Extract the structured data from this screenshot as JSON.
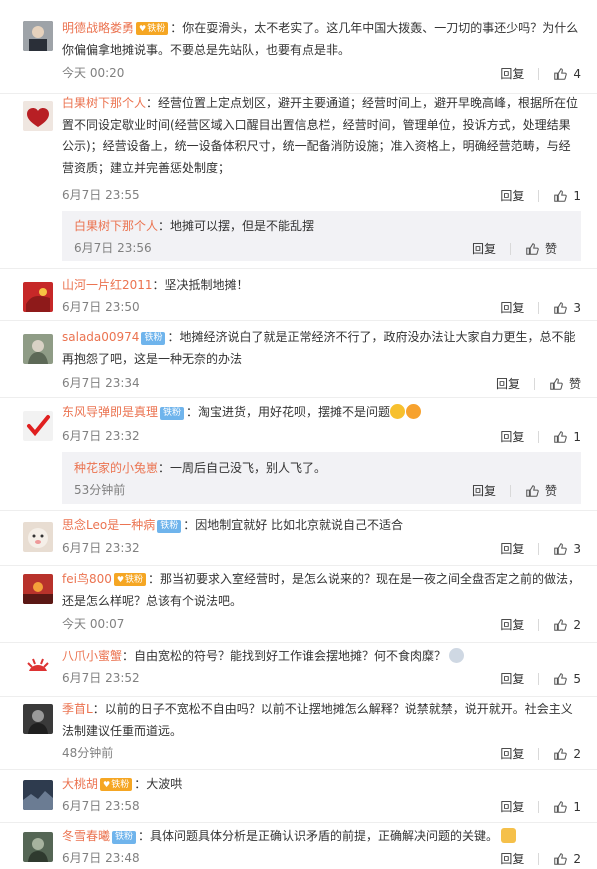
{
  "labels": {
    "reply": "回复",
    "like": "赞"
  },
  "comments": [
    {
      "user": "明德战略娄勇",
      "badge": "铁粉",
      "badge_vip": true,
      "text": "：你在耍滑头，太不老实了。这几年中国大拨轰、一刀切的事还少吗？为什么你偏偏拿地摊说事。不要总是先站队，也要有点是非。",
      "time": "今天 00:20",
      "likes": "4",
      "avatar_color": "#6c6f74"
    },
    {
      "user": "白果树下那个人",
      "badge": "",
      "text": "：经营位置上定点划区，避开主要通道；经营时间上，避开早晚高峰，根据所在位置不同设定歇业时间(经营区域入口醒目出置信息栏，经营时间，管理单位，投诉方式，处理结果公示)；经营设备上，统一设备体积尺寸，统一配备消防设施；准入资格上，明确经营范畴，与经营资质；建立并完善惩处制度；",
      "time": "6月7日 23:55",
      "likes": "1",
      "avatar_color": "#c23b3b",
      "reply": {
        "user": "白果树下那个人",
        "text": "：地摊可以摆，但是不能乱摆",
        "time": "6月7日 23:56",
        "likes": "赞"
      }
    },
    {
      "user": "山河一片红2011",
      "badge": "",
      "text": "：坚决抵制地摊！",
      "time": "6月7日 23:50",
      "likes": "3",
      "avatar_color": "#d23a2a"
    },
    {
      "user": "salada00974",
      "badge": "铁粉",
      "text": "：地摊经济说白了就是正常经济不行了，政府没办法让大家自力更生，总不能再抱怨了吧，这是一种无奈的办法",
      "time": "6月7日 23:34",
      "likes": "赞",
      "avatar_color": "#7b8a72"
    },
    {
      "user": "东风导弹即是真理",
      "badge": "铁粉",
      "text": "：淘宝进货，用好花呗，摆摊不是问题",
      "time": "6月7日 23:32",
      "likes": "1",
      "avatar_color": "#e8e8e8",
      "reply": {
        "user": "种花家的小兔崽",
        "text": "：一周后自己没飞，别人飞了。",
        "time": "53分钟前",
        "likes": "赞"
      }
    },
    {
      "user": "思念Leo是一种病",
      "badge": "铁粉",
      "text": "：因地制宜就好 比如北京就说自己不适合",
      "time": "6月7日 23:32",
      "likes": "3",
      "avatar_color": "#d8c8b8"
    },
    {
      "user": "fei鸟800",
      "badge": "铁粉",
      "badge_vip": true,
      "text": "：那当初要求入室经营时，是怎么说来的？现在是一夜之间全盘否定之前的做法，还是怎么样呢？总该有个说法吧。",
      "time": "今天 00:07",
      "likes": "2",
      "avatar_color": "#c0392b"
    },
    {
      "user": "八爪小蜜蟹",
      "badge": "",
      "text": "：自由宽松的符号？能找到好工作谁会摆地摊？何不食肉糜？",
      "time": "6月7日 23:52",
      "likes": "5",
      "avatar_color": "#d94040"
    },
    {
      "user": "季苜L",
      "badge": "",
      "text": "：以前的日子不宽松不自由吗？以前不让摆地摊怎么解释？说禁就禁，说开就开。社会主义法制建议任重而道远。",
      "time": "48分钟前",
      "likes": "2",
      "avatar_color": "#4a4a4a"
    },
    {
      "user": "大桃胡",
      "badge": "铁粉",
      "badge_vip": true,
      "text": "：大波哄",
      "time": "6月7日 23:58",
      "likes": "1",
      "avatar_color": "#3d4a5c"
    },
    {
      "user": "冬雪春曦",
      "badge": "铁粉",
      "text": "：具体问题具体分析是正确认识矛盾的前提，正确解决问题的关键。",
      "time": "6月7日 23:48",
      "likes": "2",
      "avatar_color": "#5a6b5a"
    }
  ]
}
